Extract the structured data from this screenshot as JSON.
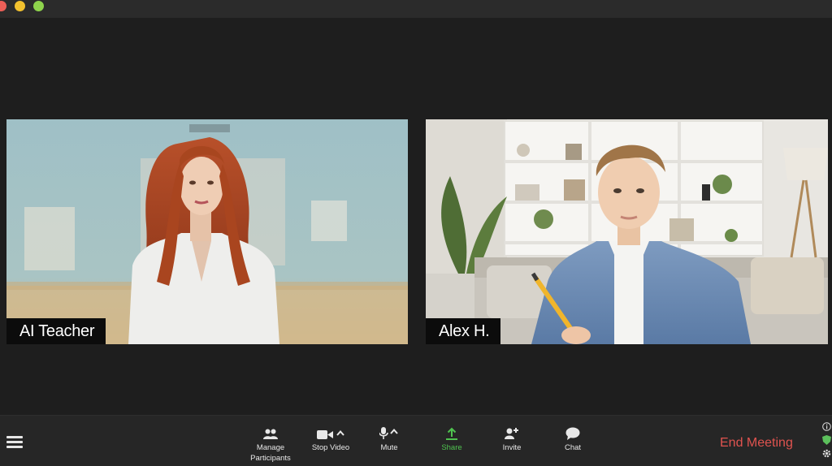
{
  "window": {
    "controls": [
      "close",
      "minimize",
      "zoom"
    ]
  },
  "participants": [
    {
      "name": "AI Teacher"
    },
    {
      "name": "Alex H."
    }
  ],
  "toolbar": {
    "manage_participants_label_line1": "Manage",
    "manage_participants_label_line2": "Participants",
    "stop_video_label": "Stop Video",
    "mute_label": "Mute",
    "share_label": "Share",
    "invite_label": "Invite",
    "chat_label": "Chat",
    "end_meeting_label": "End Meeting"
  },
  "colors": {
    "background": "#1e1e1e",
    "toolbar": "#262626",
    "share_accent": "#4fc24f",
    "end_meeting": "#e0534f"
  },
  "icons": [
    "menu-icon",
    "participants-icon",
    "video-camera-icon",
    "microphone-icon",
    "share-arrow-icon",
    "add-user-icon",
    "chat-bubble-icon",
    "info-icon",
    "shield-icon",
    "gear-icon"
  ]
}
